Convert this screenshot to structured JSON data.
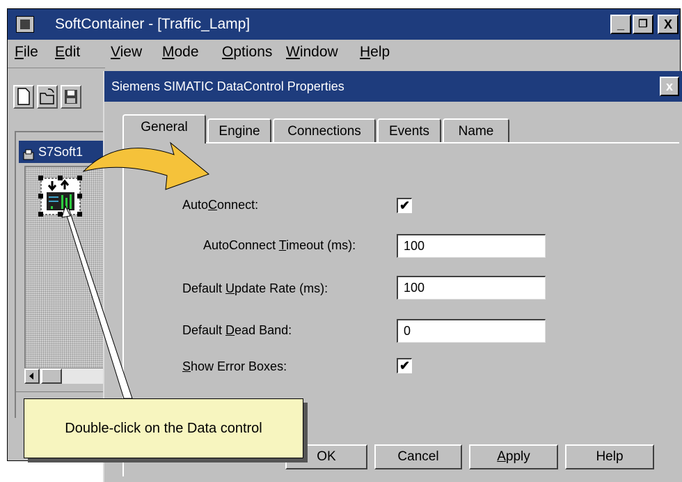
{
  "app": {
    "title": "SoftContainer - [Traffic_Lamp]",
    "menu": [
      "File",
      "Edit",
      "View",
      "Mode",
      "Options",
      "Window",
      "Help"
    ],
    "window_buttons": [
      "_",
      "❐",
      "X"
    ]
  },
  "child_window": {
    "title": "S7Soft1"
  },
  "dialog": {
    "title": "Siemens SIMATIC DataControl Properties",
    "close_label": "x",
    "tabs": [
      "General",
      "Engine",
      "Connections",
      "Events",
      "Name"
    ],
    "active_tab": "General",
    "fields": {
      "autoconnect_label_pre": "Auto",
      "autoconnect_label_u": "C",
      "autoconnect_label_post": "onnect:",
      "autoconnect_checked": "✔",
      "timeout_label_pre": "AutoConnect ",
      "timeout_label_u": "T",
      "timeout_label_post": "imeout (ms):",
      "timeout_value": "100",
      "update_label_pre": "Default ",
      "update_label_u": "U",
      "update_label_post": "pdate Rate (ms):",
      "update_value": "100",
      "deadband_label_pre": "Default ",
      "deadband_label_u": "D",
      "deadband_label_post": "ead Band:",
      "deadband_value": "0",
      "errorboxes_label_u": "S",
      "errorboxes_label_post": "how Error Boxes:",
      "errorboxes_checked": "✔"
    },
    "buttons": {
      "ok": "OK",
      "cancel": "Cancel",
      "apply_u": "A",
      "apply_post": "pply",
      "help": "Help"
    }
  },
  "callout": {
    "text": "Double-click on the Data control"
  },
  "colors": {
    "titlebar": "#1e3c7d",
    "face": "#c0c0c0",
    "callout": "#f7f5bf",
    "arrow": "#f5c23a"
  }
}
